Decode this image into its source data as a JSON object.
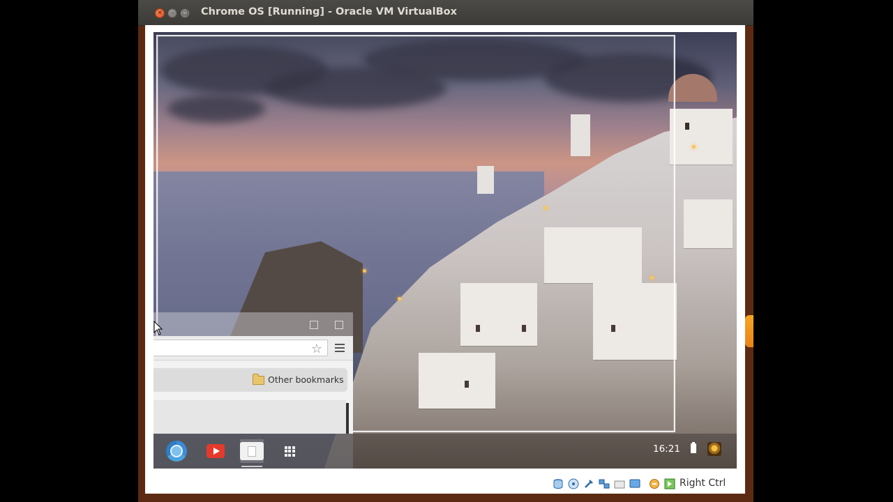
{
  "window": {
    "title": "Chrome OS [Running] - Oracle VM VirtualBox",
    "close_glyph": "✕",
    "min_glyph": "–",
    "max_glyph": "□"
  },
  "browser": {
    "bookmarks_bar": {
      "items": [
        {
          "label": "Other bookmarks",
          "icon": "folder-icon"
        }
      ]
    },
    "star_glyph": "☆"
  },
  "shelf": {
    "apps": [
      {
        "name": "chrome",
        "icon": "chrome-icon"
      },
      {
        "name": "youtube",
        "icon": "youtube-icon"
      },
      {
        "name": "files",
        "icon": "files-icon",
        "active": true
      },
      {
        "name": "app-launcher",
        "icon": "apps-grid-icon"
      }
    ],
    "clock": "16:21",
    "battery_icon": "battery-icon",
    "avatar_icon": "user-avatar"
  },
  "statusbar": {
    "icons": [
      "hard-disk-icon",
      "optical-drive-icon",
      "usb-icon",
      "network-icon",
      "shared-folders-icon",
      "display-icon",
      "video-capture-icon",
      "mouse-integration-icon"
    ],
    "host_key": "Right Ctrl"
  },
  "colors": {
    "titlebar": "#3c3b37",
    "window_frame": "#5c2a12",
    "close_button": "#e05a2b"
  }
}
